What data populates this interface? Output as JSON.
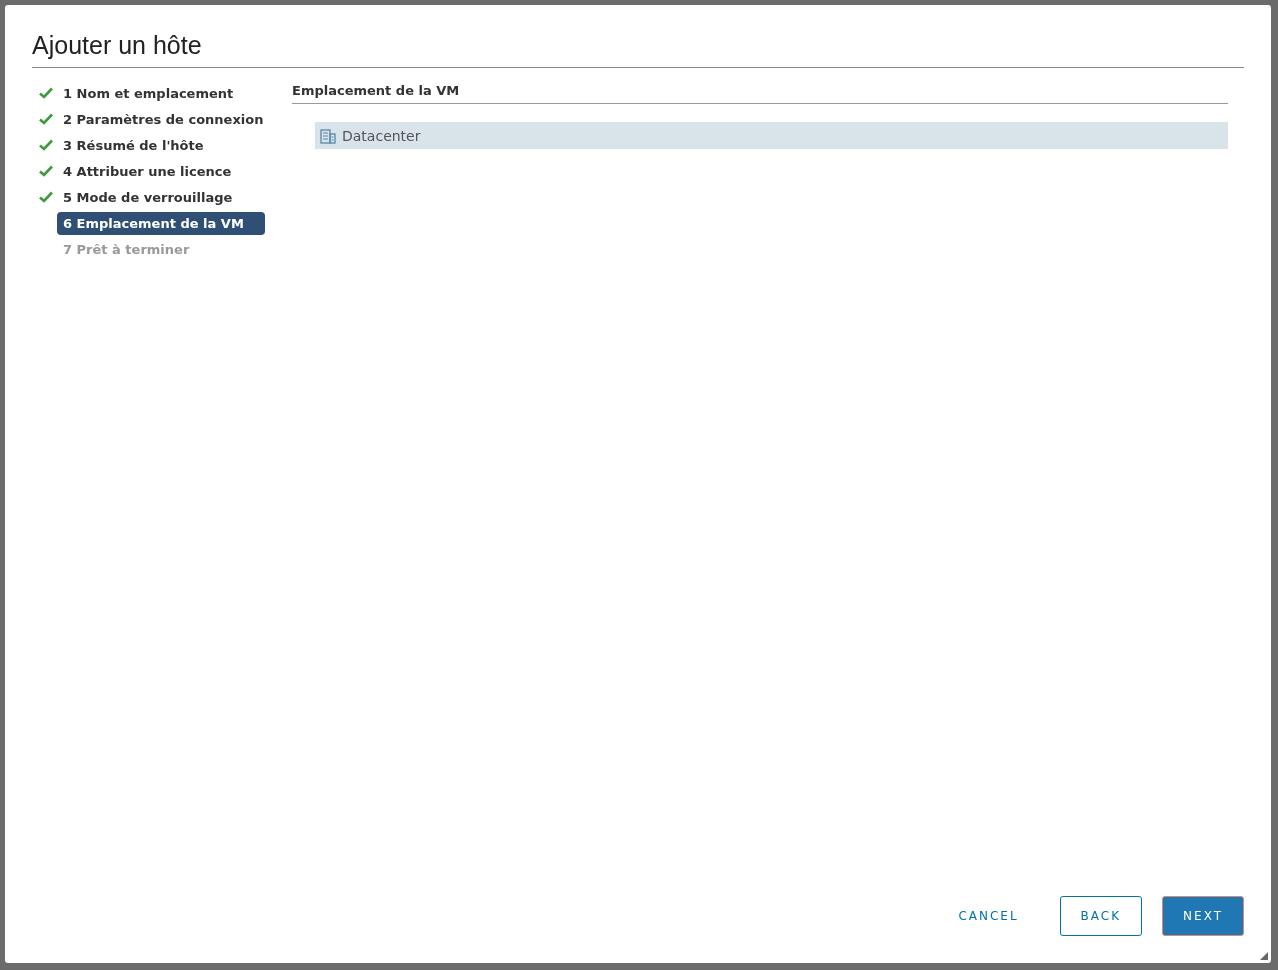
{
  "dialog": {
    "title": "Ajouter un hôte"
  },
  "steps": [
    {
      "label": "1 Nom et emplacement",
      "completed": true,
      "selected": false,
      "disabled": false
    },
    {
      "label": "2 Paramètres de connexion",
      "completed": true,
      "selected": false,
      "disabled": false
    },
    {
      "label": "3 Résumé de l'hôte",
      "completed": true,
      "selected": false,
      "disabled": false
    },
    {
      "label": "4 Attribuer une licence",
      "completed": true,
      "selected": false,
      "disabled": false
    },
    {
      "label": "5 Mode de verrouillage",
      "completed": true,
      "selected": false,
      "disabled": false
    },
    {
      "label": "6 Emplacement de la VM",
      "completed": false,
      "selected": true,
      "disabled": false
    },
    {
      "label": "7 Prêt à terminer",
      "completed": false,
      "selected": false,
      "disabled": true
    }
  ],
  "content": {
    "heading": "Emplacement de la VM",
    "tree": [
      {
        "label": "Datacenter",
        "selected": true
      }
    ]
  },
  "buttons": [
    {
      "label": "CANCEL",
      "kind": "link"
    },
    {
      "label": "BACK",
      "kind": "outline"
    },
    {
      "label": "NEXT",
      "kind": "primary"
    }
  ]
}
